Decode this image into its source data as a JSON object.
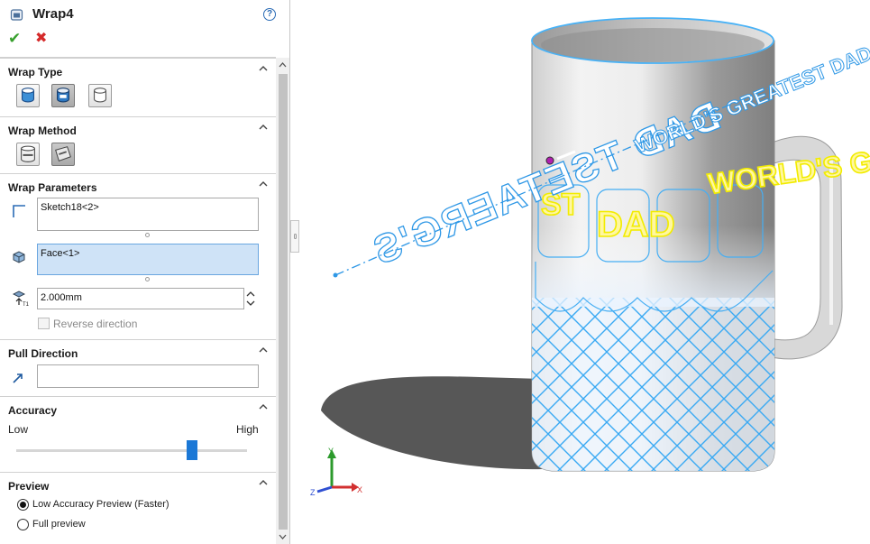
{
  "feature": {
    "title": "Wrap4",
    "help": "?",
    "ok": "✔",
    "cancel": "✖"
  },
  "sections": {
    "wrap_type": {
      "title": "Wrap Type",
      "types": [
        "emboss-icon",
        "deboss-icon",
        "scribe-icon"
      ]
    },
    "wrap_method": {
      "title": "Wrap Method",
      "methods": [
        "analytical-icon",
        "spline-surface-icon"
      ]
    },
    "wrap_params": {
      "title": "Wrap Parameters",
      "sketch_value": "Sketch18<2>",
      "face_value": "Face<1>",
      "thickness_value": "2.000mm",
      "reverse_label": "Reverse direction"
    },
    "pull": {
      "title": "Pull Direction",
      "value": ""
    },
    "accuracy": {
      "title": "Accuracy",
      "low": "Low",
      "high": "High",
      "level": 0.76
    },
    "preview": {
      "title": "Preview",
      "option1": "Low Accuracy Preview (Faster)",
      "option2": "Full preview",
      "selected": "option1"
    }
  },
  "viewport": {
    "text_world": "WORLD'S GREATEST DAD",
    "text_dad": "DAD",
    "text_worlds": "WORLD'S G",
    "text_st": "ST",
    "text_reflect": "DAD TSETAERG'S",
    "triad": {
      "x": "X",
      "y": "Y",
      "z": "Z"
    }
  },
  "colors": {
    "accent": "#2a6bb5",
    "wrap_text": "#f2ec00",
    "edge_blue": "#3aa9f0",
    "selection": "#cfe3f7"
  }
}
